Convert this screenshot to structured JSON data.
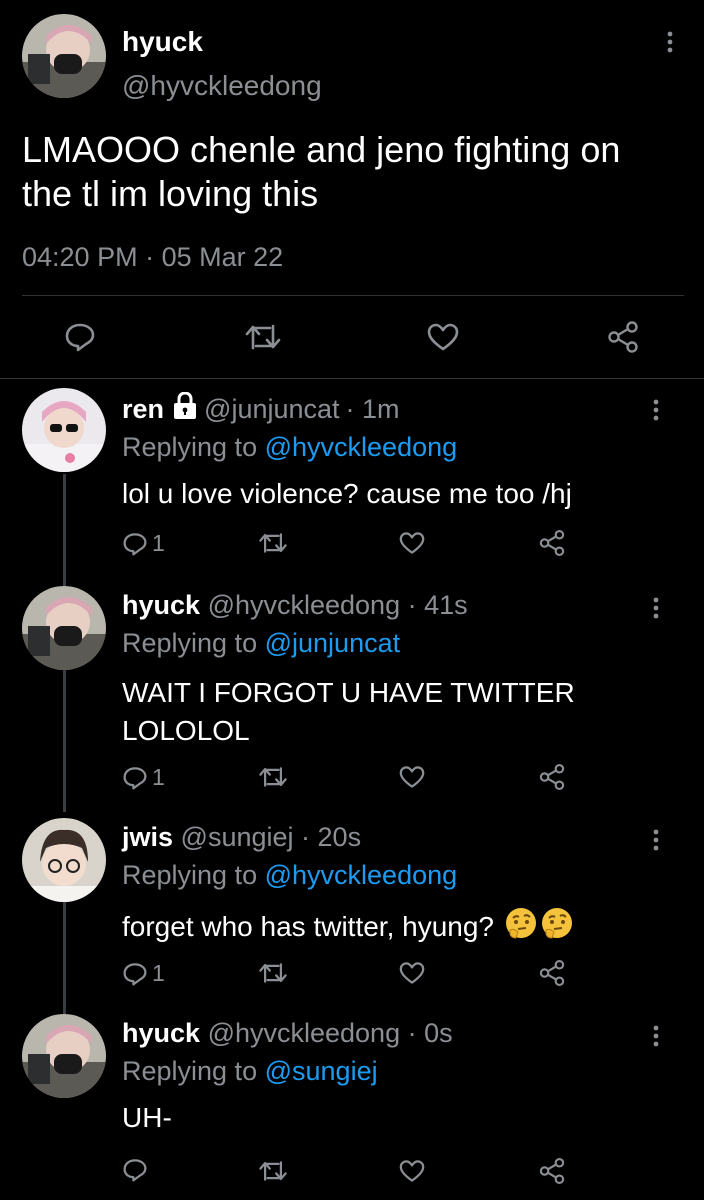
{
  "main_tweet": {
    "display_name": "hyuck",
    "handle": "@hyvckleedong",
    "text_line1": "LMAOOO chenle and jeno fighting on",
    "text_line2": "the tl im loving this",
    "time": "04:20 PM",
    "separator": "·",
    "date": "05 Mar 22"
  },
  "replies": [
    {
      "name": "ren",
      "handle": "@junjuncat",
      "age": "· 1m",
      "replying_prefix": "Replying to",
      "replying_to": "@hyvckleedong",
      "text_line1": "lol u love violence? cause me too /hj",
      "text_line2": "",
      "reply_count": "1",
      "locked": true
    },
    {
      "name": "hyuck",
      "handle": "@hyvckleedong",
      "age": "· 41s",
      "replying_prefix": "Replying to",
      "replying_to": "@junjuncat",
      "text_line1": "WAIT I FORGOT U HAVE TWITTER",
      "text_line2": "LOLOLOL",
      "reply_count": "1"
    },
    {
      "name": "jwis",
      "handle": "@sungiej",
      "age": "· 20s",
      "replying_prefix": "Replying to",
      "replying_to": "@hyvckleedong",
      "text_line1": "forget who has twitter, hyung?",
      "text_line2": "",
      "reply_count": "1",
      "emojis": "thinking-face-emoji x2"
    },
    {
      "name": "hyuck",
      "handle": "@hyvckleedong",
      "age": "· 0s",
      "replying_prefix": "Replying to",
      "replying_to": "@sungiej",
      "text_line1": "UH-",
      "text_line2": "",
      "reply_count": ""
    }
  ],
  "colors": {
    "background": "#000000",
    "text": "#ffffff",
    "muted": "#8b8f94",
    "link": "#1d9bf0",
    "divider": "#2f3336",
    "thread_line": "#3a3d41"
  }
}
